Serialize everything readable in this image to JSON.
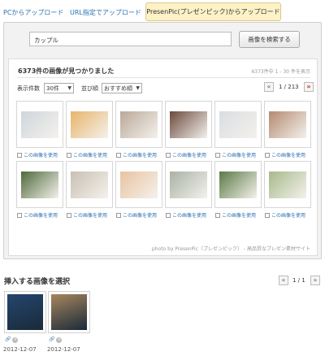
{
  "tabs": {
    "pc_upload": "PCからアップロード",
    "url_upload": "URL指定でアップロード",
    "presenpic_upload": "PresenPic(プレゼンピック)からアップロード"
  },
  "search": {
    "value": "カップル",
    "button_label": "画像を検索する"
  },
  "results": {
    "count_label": "6373件の画像が見つかりました",
    "range_label": "6373件中 1 - 30 件を表示",
    "per_page_label": "表示件数",
    "per_page_value": "30件",
    "sort_label": "並び順",
    "sort_value": "おすすめ順",
    "pager": {
      "prev": "«",
      "page_text": "1 / 213",
      "next": "»"
    },
    "use_label": "この画像を使用",
    "credit": "photo by PresenPic（プレゼンピック） - 高品質なプレゼン素材サイト",
    "thumbnails": [
      {
        "icon": "couple-sofa-photo",
        "color": "#cfd6dc"
      },
      {
        "icon": "couple-illustration",
        "color": "#e8b46a"
      },
      {
        "icon": "couple-living-room-photo",
        "color": "#b9a998"
      },
      {
        "icon": "couple-embrace-photo",
        "color": "#6b4a3c"
      },
      {
        "icon": "couple-standing-photo",
        "color": "#d9dde2"
      },
      {
        "icon": "couple-market-photo",
        "color": "#b48a70"
      },
      {
        "icon": "couple-park-photo",
        "color": "#4e6a3a"
      },
      {
        "icon": "couple-sofa-photo-2",
        "color": "#c9c0b3"
      },
      {
        "icon": "couple-laptop-illustration",
        "color": "#e9c3a0"
      },
      {
        "icon": "couple-window-photo",
        "color": "#a8b2a5"
      },
      {
        "icon": "couple-tree-photo",
        "color": "#5b7a46"
      },
      {
        "icon": "couple-field-photo",
        "color": "#a7b98a"
      }
    ]
  },
  "selection": {
    "title": "挿入する画像を選択",
    "pager": {
      "prev": "«",
      "page_text": "1 / 1",
      "next": "»"
    },
    "items": [
      {
        "icon": "city-night-photo",
        "color": "#24466e",
        "date": "2012-12-07"
      },
      {
        "icon": "person-phone-photo",
        "color": "#a7865d",
        "date": "2012-12-07"
      }
    ]
  }
}
